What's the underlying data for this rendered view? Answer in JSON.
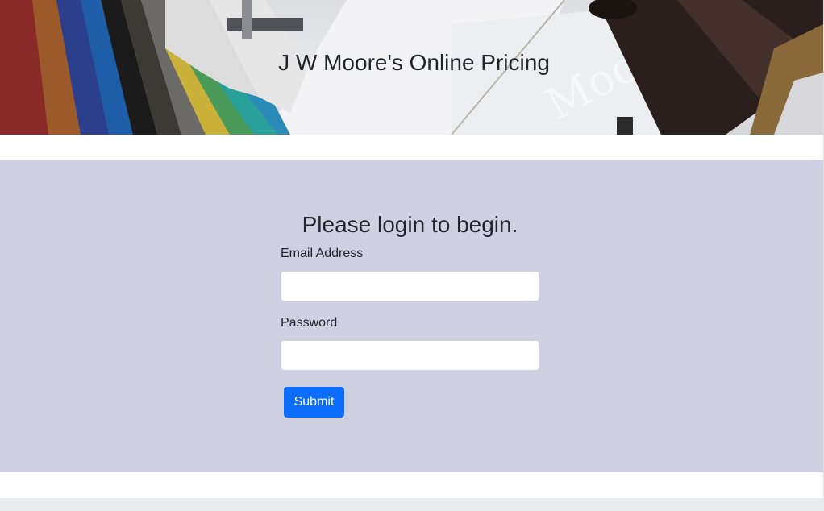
{
  "header": {
    "title": "J W Moore's Online Pricing"
  },
  "login": {
    "heading": "Please login to begin.",
    "email_label": "Email Address",
    "email_value": "",
    "password_label": "Password",
    "password_value": "",
    "submit_label": "Submit"
  },
  "colors": {
    "panel_background": "#cfd1e3",
    "button_primary": "#0d6efd",
    "footer_background": "#e9ecef"
  }
}
